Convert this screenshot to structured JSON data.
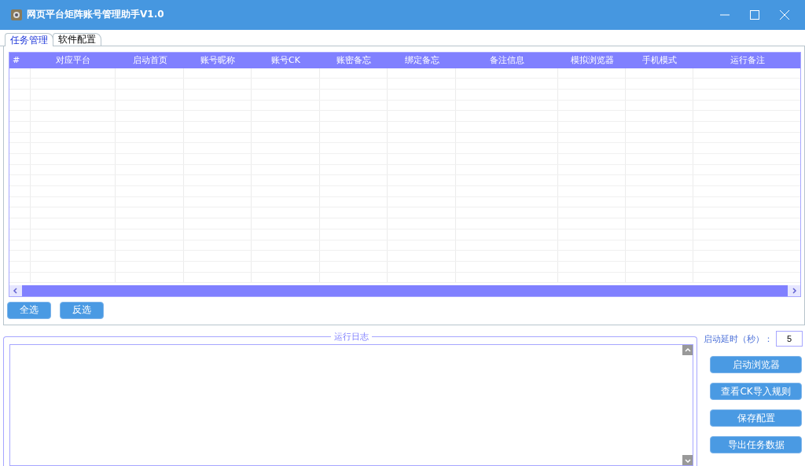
{
  "window": {
    "title": "网页平台矩阵账号管理助手V1.0"
  },
  "tabs": [
    {
      "label": "任务管理",
      "selected": true
    },
    {
      "label": "软件配置",
      "selected": false
    }
  ],
  "table": {
    "columns": [
      "#",
      "对应平台",
      "启动首页",
      "账号昵称",
      "账号CK",
      "账密备忘",
      "绑定备忘",
      "备注信息",
      "模拟浏览器",
      "手机模式",
      "运行备注"
    ]
  },
  "table_buttons": [
    "全选",
    "反选"
  ],
  "log": {
    "legend": "运行日志"
  },
  "settings": {
    "delay_label": "启动延时（秒）：",
    "delay_value": "5"
  },
  "actions": [
    "启动浏览器",
    "查看CK导入规则",
    "保存配置",
    "导出任务数据"
  ]
}
